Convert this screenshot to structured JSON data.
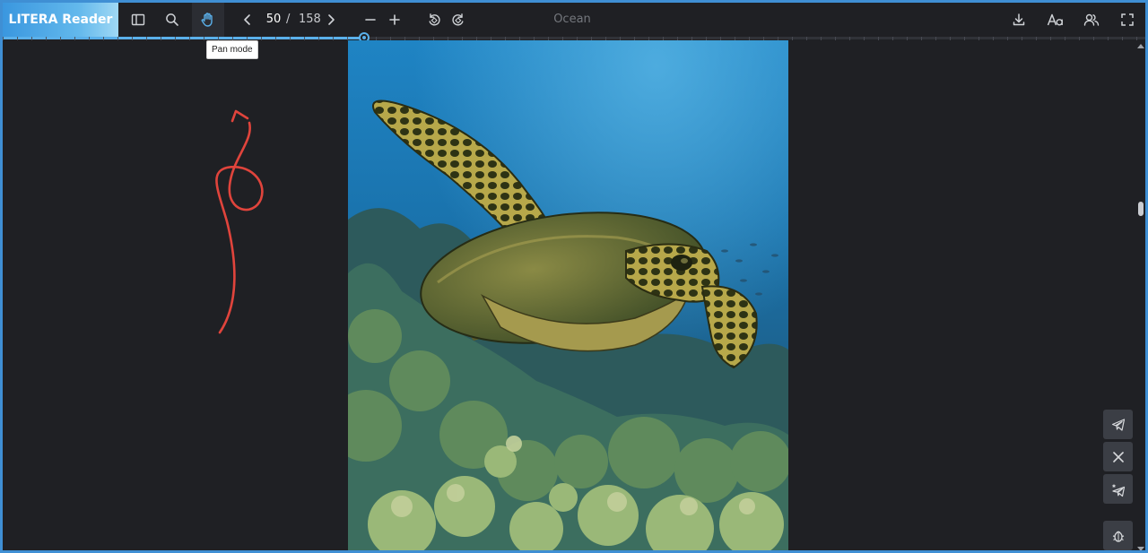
{
  "app": {
    "brand": "LITERA Reader"
  },
  "toolbar": {
    "sidebar_icon": "sidebar-icon",
    "search_icon": "search-icon",
    "pan_icon": "hand-icon",
    "prev_icon": "chevron-left-icon",
    "next_icon": "chevron-right-icon",
    "zoom_out_icon": "minus-icon",
    "zoom_in_icon": "plus-icon",
    "rotate_left_icon": "rotate-left-icon",
    "rotate_right_icon": "rotate-right-icon",
    "download_icon": "download-icon",
    "font_icon": "font-size-icon",
    "users_icon": "users-icon",
    "fullscreen_icon": "fullscreen-icon",
    "accent_color": "#5ab0ea"
  },
  "pagination": {
    "current": "50",
    "separator": "/",
    "total": "158"
  },
  "progress": {
    "fraction": 0.316
  },
  "document": {
    "title": "Ocean"
  },
  "tooltip": {
    "text": "Pan mode"
  },
  "page": {
    "image_subject": "sea turtle swimming over coral reef"
  },
  "annotation": {
    "color": "#e0443c",
    "shape": "red hand-drawn arrow with loop"
  },
  "side_actions": [
    {
      "icon": "telegram-icon"
    },
    {
      "icon": "x-icon"
    },
    {
      "icon": "telegram-star-icon"
    },
    {
      "icon": "bug-icon"
    }
  ]
}
